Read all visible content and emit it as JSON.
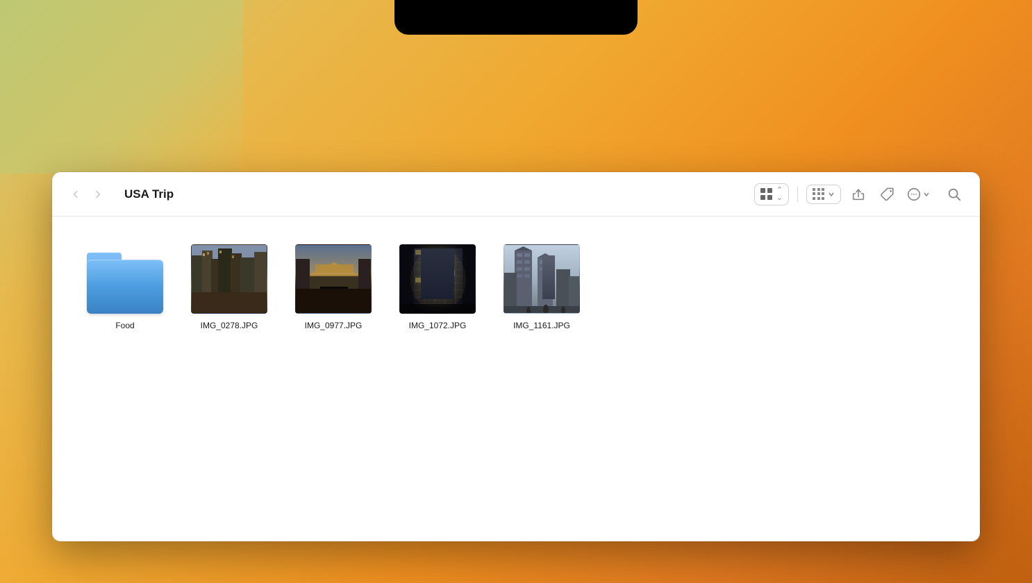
{
  "desktop": {
    "background_desc": "macOS warm orange gradient desktop"
  },
  "window": {
    "title": "USA Trip",
    "toolbar": {
      "back_label": "‹",
      "forward_label": "›",
      "view_switcher_tooltip": "Icon View",
      "group_tooltip": "Group",
      "share_tooltip": "Share",
      "tag_tooltip": "Tag",
      "more_tooltip": "More",
      "search_tooltip": "Search"
    },
    "content": {
      "items": [
        {
          "type": "folder",
          "name": "Food"
        },
        {
          "type": "image",
          "name": "IMG_0278.JPG",
          "desc": "NYC street scene with tall buildings"
        },
        {
          "type": "image",
          "name": "IMG_0977.JPG",
          "desc": "ROW NY building entrance"
        },
        {
          "type": "image",
          "name": "IMG_1072.JPG",
          "desc": "Dark glass skyscraper at night"
        },
        {
          "type": "image",
          "name": "IMG_1161.JPG",
          "desc": "Twin tower style buildings"
        }
      ]
    }
  }
}
